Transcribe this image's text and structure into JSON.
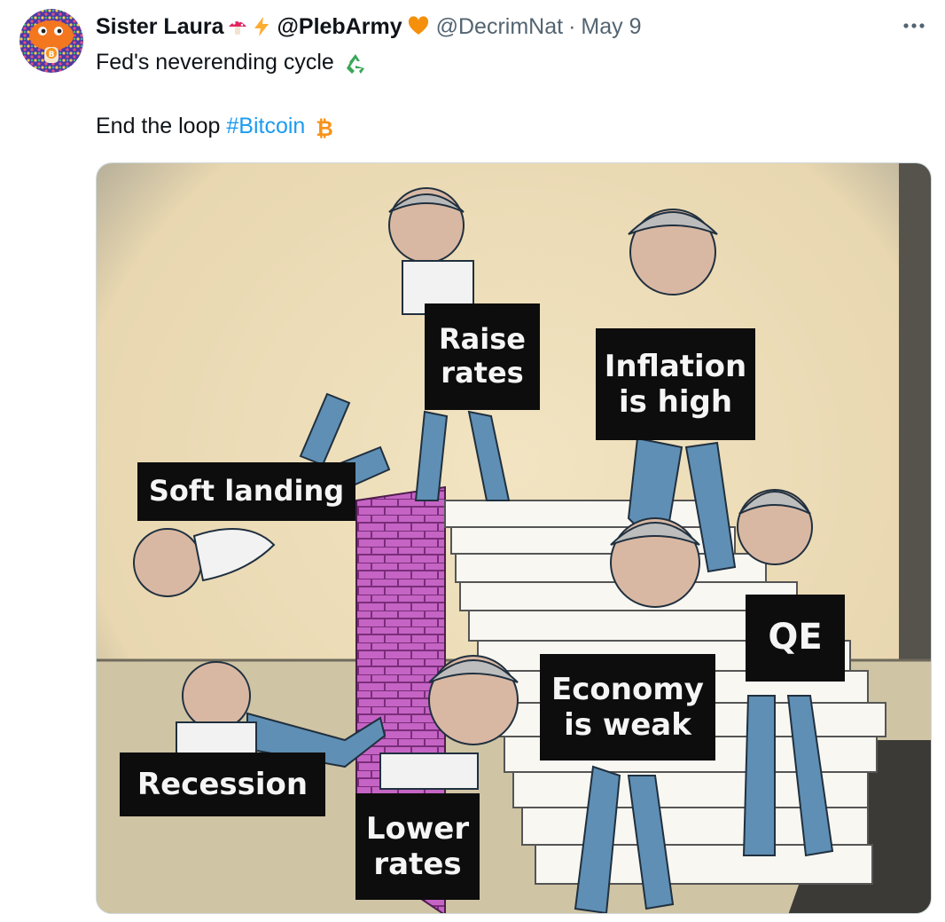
{
  "tweet": {
    "display_name": "Sister Laura",
    "name_emojis": [
      "mushroom-icon",
      "lightning-icon"
    ],
    "plebarmy_label": "@PlebArmy",
    "handle": "@DecrimNat",
    "date": "May 9",
    "separator": "·",
    "more_label": "...",
    "line1": "Fed's neverending cycle",
    "line2_prefix": "End the loop",
    "hashtag": "#Bitcoin",
    "accent_color": "#1d9bf0"
  },
  "meme": {
    "captions": {
      "raise": "Raise\nrates",
      "inflation": "Inflation\nis high",
      "soft": "Soft landing",
      "qe": "QE",
      "economy": "Economy\nis weak",
      "recession": "Recession",
      "lower": "Lower\nrates"
    }
  }
}
